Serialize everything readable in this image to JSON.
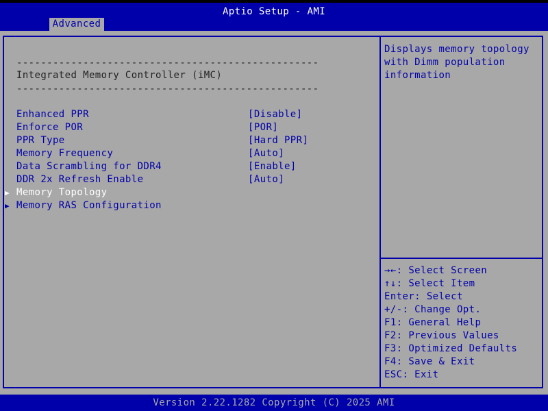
{
  "app": {
    "title": "Aptio Setup - AMI",
    "active_tab": "Advanced"
  },
  "section": {
    "separator": "--------------------------------------------------",
    "heading": "Integrated Memory Controller (iMC)"
  },
  "settings": [
    {
      "label": "Enhanced PPR",
      "value": "[Disable]"
    },
    {
      "label": "Enforce POR",
      "value": "[POR]"
    },
    {
      "label": "PPR Type",
      "value": "[Hard PPR]"
    },
    {
      "label": "Memory Frequency",
      "value": "[Auto]"
    },
    {
      "label": "Data Scrambling for DDR4",
      "value": "[Enable]"
    },
    {
      "label": "DDR 2x Refresh Enable",
      "value": "[Auto]"
    }
  ],
  "submenus": [
    {
      "label": "Memory Topology",
      "selected": true
    },
    {
      "label": "Memory RAS Configuration",
      "selected": false
    }
  ],
  "help": {
    "lines": [
      "Displays memory topology",
      "with Dimm population",
      "information"
    ]
  },
  "keys": [
    {
      "key": "→←",
      "action": ": Select Screen"
    },
    {
      "key": "↑↓",
      "action": ": Select Item"
    },
    {
      "key": "Enter",
      "action": ": Select"
    },
    {
      "key": "+/-",
      "action": ": Change Opt."
    },
    {
      "key": "F1",
      "action": ": General Help"
    },
    {
      "key": "F2",
      "action": ": Previous Values"
    },
    {
      "key": "F3",
      "action": ": Optimized Defaults"
    },
    {
      "key": "F4",
      "action": ": Save & Exit"
    },
    {
      "key": "ESC",
      "action": ": Exit"
    }
  ],
  "footer": {
    "text": "Version 2.22.1282 Copyright (C) 2025 AMI"
  },
  "colors": {
    "background": "#a8a8a8",
    "accent": "#0000aa",
    "highlight": "#ffffff"
  }
}
